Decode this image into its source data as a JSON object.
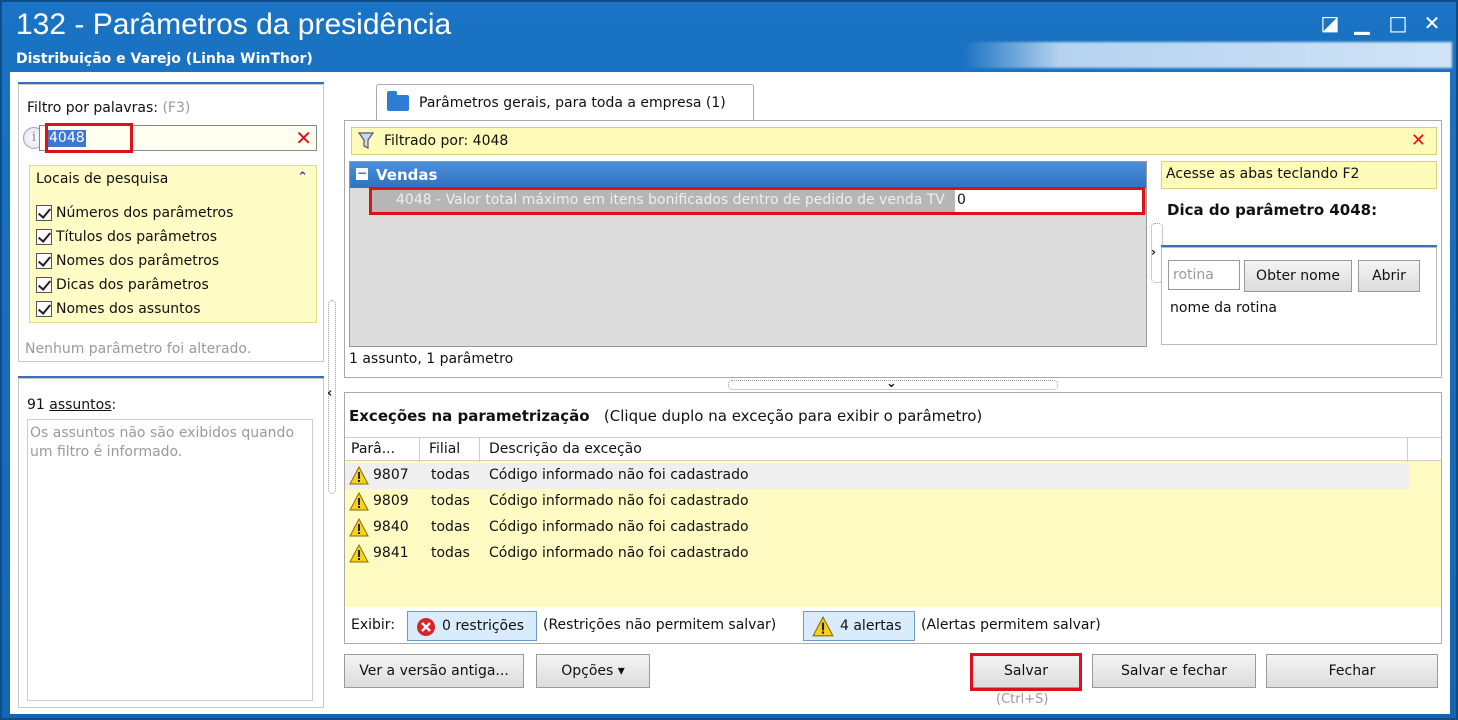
{
  "window": {
    "title": "132 - Parâmetros da presidência",
    "subtitle": "Distribuição e Varejo (Linha WinThor)",
    "controls": {
      "restore": "◪",
      "minimize": "▁",
      "maximize": "□",
      "close": "✕"
    }
  },
  "filter": {
    "label": "Filtro por palavras:",
    "hint": "(F3)",
    "value": "4048",
    "clear": "✕",
    "info": "i"
  },
  "search_locations": {
    "title": "Locais de pesquisa",
    "collapse": "⌃",
    "items": [
      {
        "label": "Números dos parâmetros",
        "checked": true
      },
      {
        "label": "Títulos dos parâmetros",
        "checked": true
      },
      {
        "label": "Nomes dos parâmetros",
        "checked": true
      },
      {
        "label": "Dicas dos parâmetros",
        "checked": true
      },
      {
        "label": "Nomes dos assuntos",
        "checked": true
      }
    ]
  },
  "status_left": "Nenhum parâmetro foi alterado.",
  "subjects": {
    "count_prefix": "91 ",
    "count_word": "assuntos",
    "count_suffix": ":",
    "note": "Os assuntos não são exibidos quando um filtro é informado."
  },
  "tab": {
    "label": "Parâmetros gerais, para toda a empresa  (1)"
  },
  "filter_banner": {
    "text": "Filtrado por: 4048",
    "close": "✕"
  },
  "grid": {
    "group_toggle": "−",
    "group": "Vendas",
    "row": {
      "text": "4048 - Valor total máximo em itens bonificados dentro de pedido de venda TV",
      "value": "0"
    },
    "status": "1 assunto, 1 parâmetro"
  },
  "tip": {
    "banner": "Acesse as abas teclando F2",
    "title": "Dica do parâmetro 4048:"
  },
  "routine": {
    "placeholder": "rotina",
    "get_name": "Obter nome",
    "open": "Abrir",
    "name_label": "nome da rotina"
  },
  "exceptions": {
    "title": "Exceções na parametrização",
    "subtitle": "(Clique duplo na exceção para exibir o parâmetro)",
    "columns": [
      "Parâ...",
      "Filial",
      "Descrição da exceção"
    ],
    "rows": [
      {
        "code": "9807",
        "branch": "todas",
        "description": "Código informado não foi cadastrado"
      },
      {
        "code": "9809",
        "branch": "todas",
        "description": "Código informado não foi cadastrado"
      },
      {
        "code": "9840",
        "branch": "todas",
        "description": "Código informado não foi cadastrado"
      },
      {
        "code": "9841",
        "branch": "todas",
        "description": "Código informado não foi cadastrado"
      }
    ],
    "show_label": "Exibir:",
    "restrictions": "0 restrições",
    "restrictions_note": "(Restrições não permitem salvar)",
    "alerts": "4 alertas",
    "alerts_note": "(Alertas permitem salvar)"
  },
  "footer": {
    "old_version": "Ver a versão antiga...",
    "options": "Opções",
    "options_arrow": "▾",
    "save": "Salvar",
    "save_shortcut": "(Ctrl+S)",
    "save_close": "Salvar e fechar",
    "close": "Fechar"
  },
  "colors": {
    "titlebar": "#1566b0",
    "highlight_red": "#e0101a",
    "banner_yellow": "#fffbb8",
    "group_blue": "#2f72c3"
  }
}
